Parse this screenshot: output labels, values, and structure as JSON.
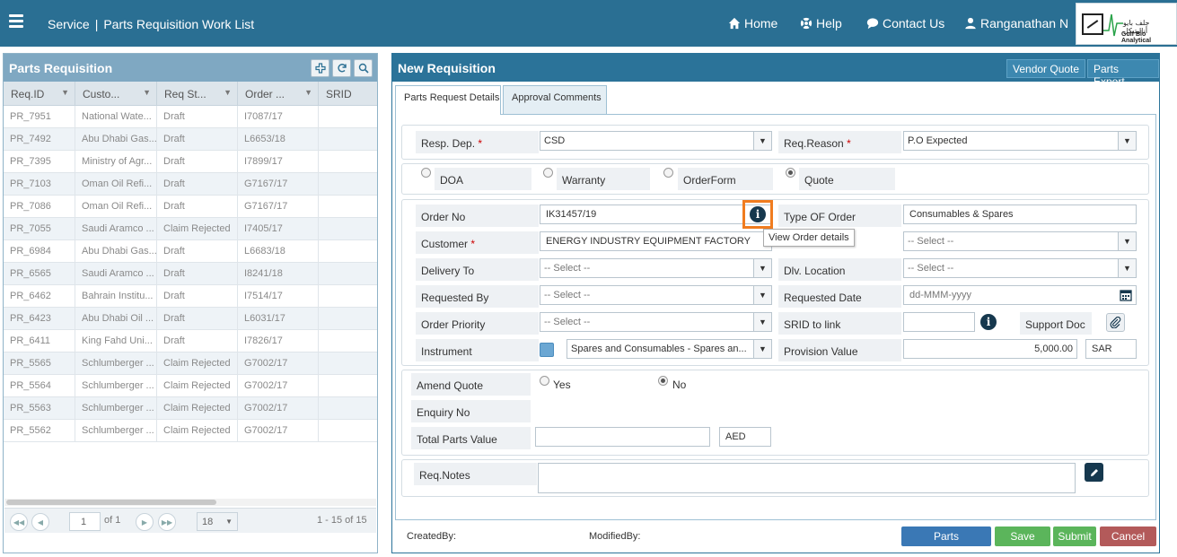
{
  "header": {
    "breadcrumb_service": "Service",
    "breadcrumb_separator": "|",
    "breadcrumb_page": "Parts Requisition Work List",
    "nav_home": "Home",
    "nav_help": "Help",
    "nav_contact": "Contact Us",
    "user_name": "Ranganathan N",
    "logo_arabic": "جلف بايو أناليتيكل",
    "logo_english": "Gulf Bio Analytical",
    "bar_color": "#2a6f93"
  },
  "left_panel": {
    "title": "Parts Requisition",
    "columns": [
      "Req.ID",
      "Custo...",
      "Req St...",
      "Order ...",
      "SRID"
    ],
    "rows": [
      [
        "PR_7951",
        "National Wate...",
        "Draft",
        "I7087/17",
        ""
      ],
      [
        "PR_7492",
        "Abu Dhabi Gas...",
        "Draft",
        "L6653/18",
        ""
      ],
      [
        "PR_7395",
        "Ministry of Agr...",
        "Draft",
        "I7899/17",
        ""
      ],
      [
        "PR_7103",
        "Oman Oil Refi...",
        "Draft",
        "G7167/17",
        ""
      ],
      [
        "PR_7086",
        "Oman Oil Refi...",
        "Draft",
        "G7167/17",
        ""
      ],
      [
        "PR_7055",
        "Saudi Aramco ...",
        "Claim Rejected",
        "I7405/17",
        ""
      ],
      [
        "PR_6984",
        "Abu Dhabi Gas...",
        "Draft",
        "L6683/18",
        ""
      ],
      [
        "PR_6565",
        "Saudi Aramco ...",
        "Draft",
        "I8241/18",
        ""
      ],
      [
        "PR_6462",
        "Bahrain Institu...",
        "Draft",
        "I7514/17",
        ""
      ],
      [
        "PR_6423",
        "Abu Dhabi Oil ...",
        "Draft",
        "L6031/17",
        ""
      ],
      [
        "PR_6411",
        "King Fahd Uni...",
        "Draft",
        "I7826/17",
        ""
      ],
      [
        "PR_5565",
        "Schlumberger ...",
        "Claim Rejected",
        "G7002/17",
        ""
      ],
      [
        "PR_5564",
        "Schlumberger ...",
        "Claim Rejected",
        "G7002/17",
        ""
      ],
      [
        "PR_5563",
        "Schlumberger ...",
        "Claim Rejected",
        "G7002/17",
        ""
      ],
      [
        "PR_5562",
        "Schlumberger ...",
        "Claim Rejected",
        "G7002/17",
        ""
      ]
    ],
    "pager": {
      "page": "1",
      "of_label": "of 1",
      "page_size": "18",
      "range_label": "1 - 15 of 15"
    }
  },
  "right_panel": {
    "title": "New Requisition",
    "vendor_quote_label": "Vendor Quote",
    "parts_export_label": "Parts Export",
    "tabs": [
      "Parts Request Details",
      "Approval Comments"
    ],
    "resp_dep_label": "Resp. Dep.",
    "resp_dep_value": "CSD",
    "req_reason_label": "Req.Reason",
    "req_reason_value": "P.O Expected",
    "required_mark": "*",
    "type_options": [
      {
        "label": "DOA",
        "selected": false
      },
      {
        "label": "Warranty",
        "selected": false
      },
      {
        "label": "OrderForm",
        "selected": false
      },
      {
        "label": "Quote",
        "selected": true
      }
    ],
    "order_no_label": "Order No",
    "order_no_value": "IK31457/19",
    "info_glyph": "i",
    "tooltip": "View Order details",
    "type_of_order_label": "Type OF Order",
    "type_of_order_value": "Consumables & Spares",
    "customer_label": "Customer",
    "customer_value": "ENERGY INDUSTRY EQUIPMENT FACTORY",
    "select_placeholder": "-- Select --",
    "delivery_to_label": "Delivery To",
    "dlv_location_label": "Dlv. Location",
    "requested_by_label": "Requested By",
    "requested_date_label": "Requested Date",
    "requested_date_placeholder": "dd-MMM-yyyy",
    "order_priority_label": "Order Priority",
    "srid_label": "SRID to link",
    "support_doc_label": "Support Doc",
    "instrument_label": "Instrument",
    "instrument_value": "Spares and Consumables - Spares an...",
    "provision_value_label": "Provision Value",
    "provision_value": "5,000.00",
    "provision_currency": "SAR",
    "amend_quote_label": "Amend Quote",
    "amend_yes": "Yes",
    "amend_no": "No",
    "amend_selected": "No",
    "enquiry_no_label": "Enquiry No",
    "total_parts_label": "Total Parts Value",
    "total_parts_value": "",
    "total_parts_currency": "AED",
    "req_notes_label": "Req.Notes",
    "req_notes_value": "",
    "created_by_label": "CreatedBy:",
    "modified_by_label": "ModifiedBy:",
    "buttons": {
      "parts": "Parts",
      "save": "Save",
      "submit": "Submit",
      "cancel": "Cancel"
    },
    "colors": {
      "parts": "#3a78b5",
      "save": "#5bb55b",
      "submit": "#5bb55b",
      "cancel": "#b35a5a",
      "highlight": "#f07c1f"
    }
  }
}
